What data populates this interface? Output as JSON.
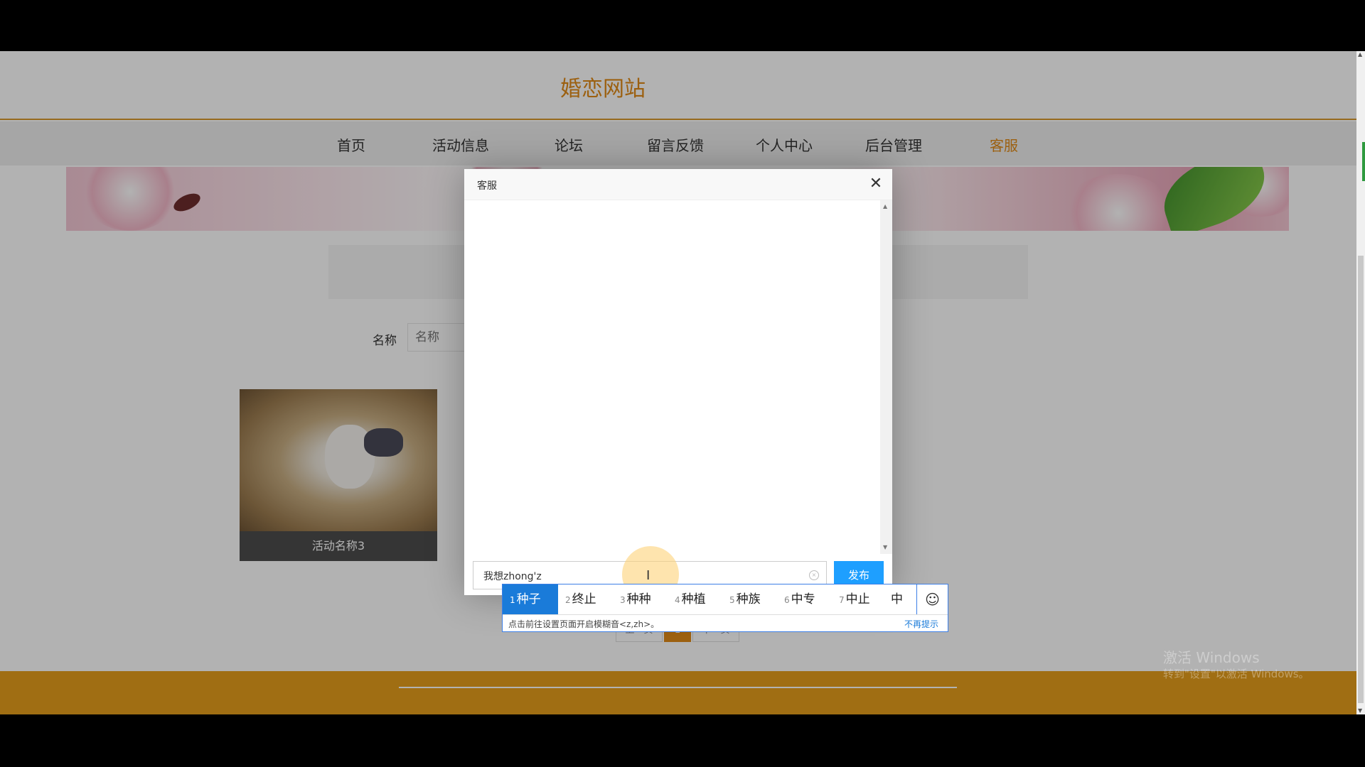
{
  "site": {
    "title": "婚恋网站",
    "nav": [
      {
        "label": "首页"
      },
      {
        "label": "活动信息"
      },
      {
        "label": "论坛"
      },
      {
        "label": "留言反馈"
      },
      {
        "label": "个人中心"
      },
      {
        "label": "后台管理"
      },
      {
        "label": "客服"
      }
    ],
    "active_nav": "客服",
    "accent_color": "#e08a17",
    "footer_color": "#e59e1c"
  },
  "search": {
    "label": "名称",
    "placeholder": "名称"
  },
  "cards": [
    {
      "caption": "活动名称3"
    }
  ],
  "pager": {
    "prev": "上一页",
    "current": "1",
    "next": "下一页"
  },
  "dialog": {
    "title": "客服",
    "close_icon": "close-icon",
    "input_value": "我想zhong'z",
    "send_label": "发布",
    "send_color": "#1e9fff"
  },
  "ime": {
    "candidates": [
      {
        "num": "1",
        "text": "种子"
      },
      {
        "num": "2",
        "text": "终止"
      },
      {
        "num": "3",
        "text": "种种"
      },
      {
        "num": "4",
        "text": "种植"
      },
      {
        "num": "5",
        "text": "种族"
      },
      {
        "num": "6",
        "text": "中专"
      },
      {
        "num": "7",
        "text": "中止"
      },
      {
        "num": "",
        "text": "中"
      }
    ],
    "selected_index": 0,
    "emoji_icon": "smiley-icon",
    "hint": "点击前往设置页面开启模糊音<z,zh>。",
    "dismiss": "不再提示",
    "highlight_color": "#1a7bd9"
  },
  "watermark": {
    "line1": "激活 Windows",
    "line2": "转到\"设置\"以激活 Windows。"
  }
}
